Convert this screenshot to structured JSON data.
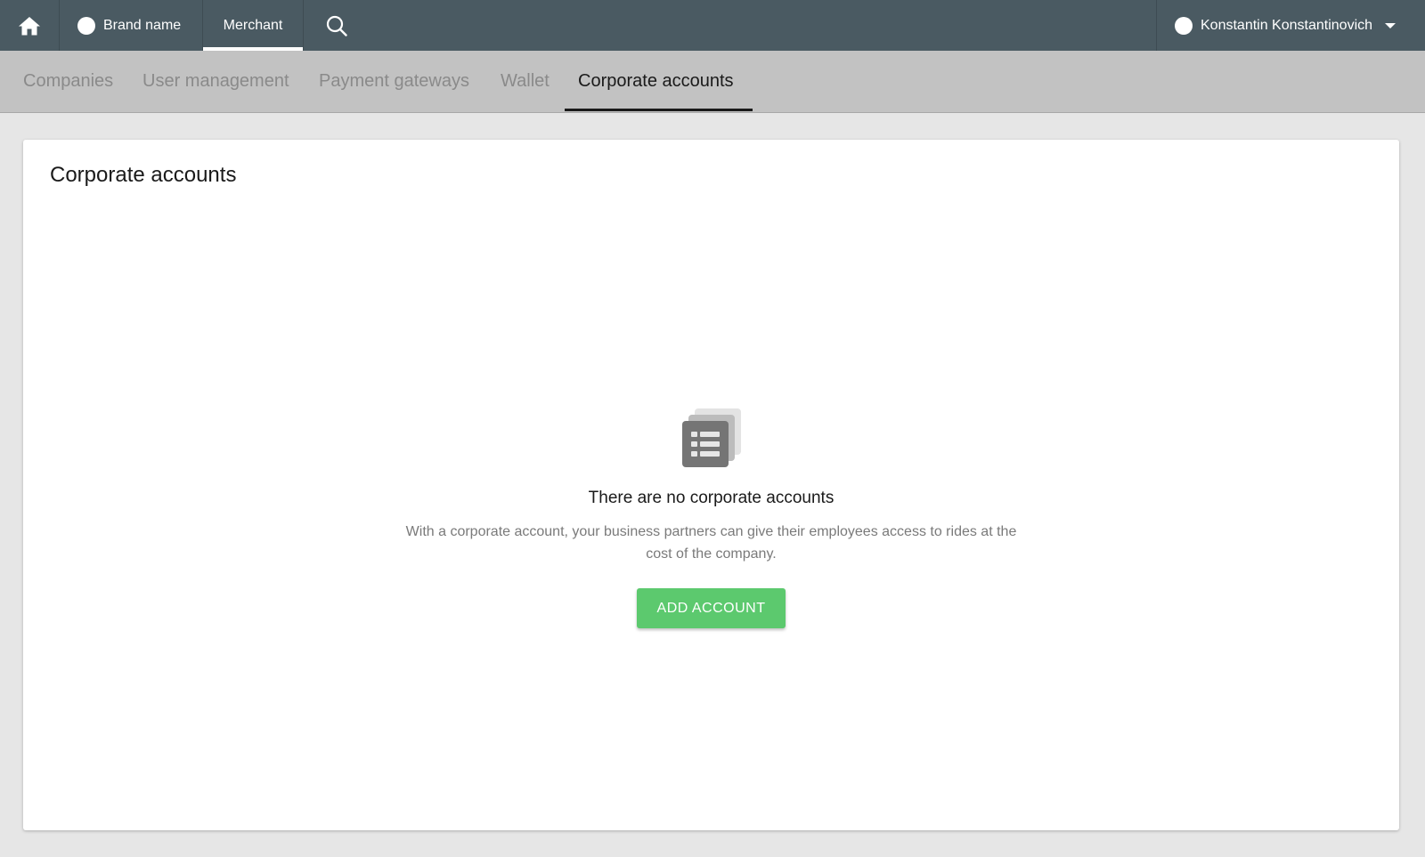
{
  "topbar": {
    "home_icon": "home-icon",
    "brand_label": "Brand name",
    "merchant_label": "Merchant",
    "search_icon": "search-icon",
    "user_name": "Konstantin Konstantinovich",
    "background_color": "#4a5a62"
  },
  "subnav": {
    "tabs": [
      {
        "label": "Companies"
      },
      {
        "label": "User management"
      },
      {
        "label": "Payment gateways"
      },
      {
        "label": "Wallet"
      },
      {
        "label": "Corporate accounts"
      }
    ],
    "active_tab": "Corporate accounts"
  },
  "main": {
    "title": "Corporate accounts",
    "empty_state": {
      "icon": "list-stack-icon",
      "heading": "There are no corporate accounts",
      "description": "With a corporate account, your business partners can give their employees access to rides at the cost of the company.",
      "button_label": "ADD ACCOUNT",
      "button_color": "#5cc96e"
    }
  }
}
